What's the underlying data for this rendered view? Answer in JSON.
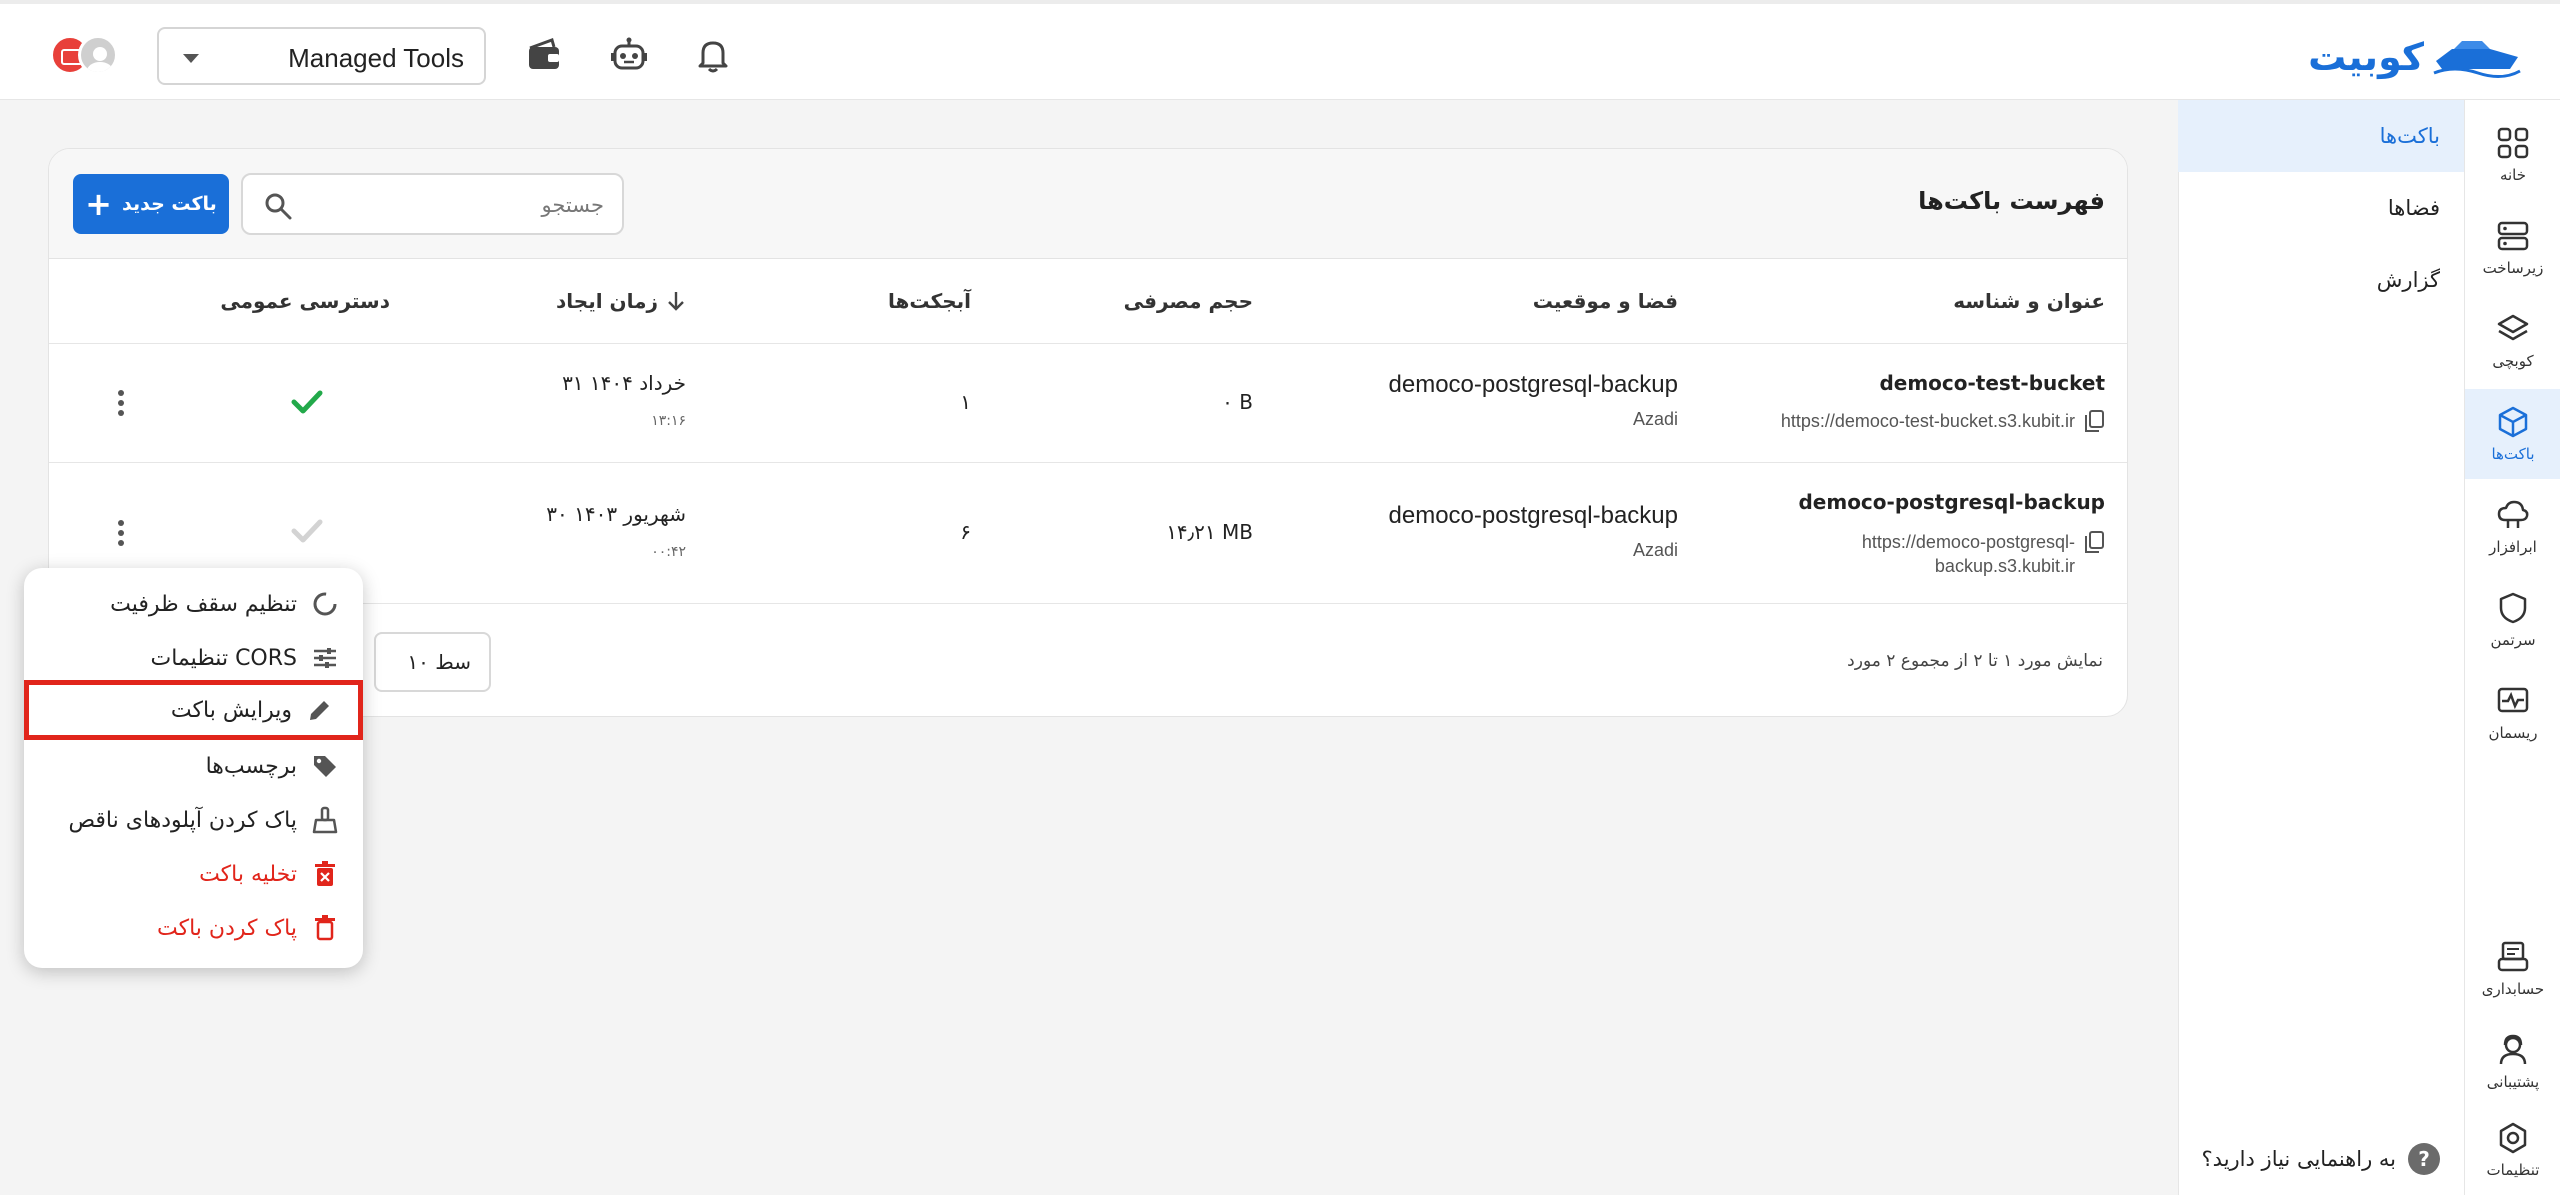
{
  "header": {
    "brand": "کوبیت",
    "project_select": "Managed Tools",
    "icons": [
      "wallet-icon",
      "robot-icon",
      "bell-icon"
    ]
  },
  "rail": [
    {
      "label": "خانه",
      "icon": "home-grid-icon"
    },
    {
      "label": "زیرساخت",
      "icon": "server-icon"
    },
    {
      "label": "کوبچی",
      "icon": "layers-icon"
    },
    {
      "label": "باکت‌ها",
      "icon": "cube-icon",
      "active": true
    },
    {
      "label": "ابرافزار",
      "icon": "cloud-icon"
    },
    {
      "label": "سرتمن",
      "icon": "shield-icon"
    },
    {
      "label": "ریسمان",
      "icon": "monitor-icon"
    },
    {
      "label": "حسابداری",
      "icon": "receipt-icon"
    },
    {
      "label": "پشتیبانی",
      "icon": "support-icon"
    },
    {
      "label": "تنظیمات",
      "icon": "settings-icon"
    }
  ],
  "subnav": {
    "items": [
      "باکت‌ها",
      "فضاها",
      "گزارش"
    ],
    "help": "به راهنمایی نیاز دارید؟",
    "help_icon": "?"
  },
  "card": {
    "title": "فهرست باکت‌ها",
    "new_button": "باکت جدید",
    "search_placeholder": "جستجو",
    "columns": {
      "name": "عنوان و شناسه",
      "space": "فضا و موقعیت",
      "size": "حجم مصرفی",
      "objects": "آبجکت‌ها",
      "created": "زمان ایجاد",
      "public": "دسترسی عمومی"
    },
    "rows": [
      {
        "name": "democo-test-bucket",
        "url": "https://democo-test-bucket.s3.kubit.ir",
        "space": "democo-postgresql-backup",
        "location": "Azadi",
        "size": "۰ B",
        "objects": "۱",
        "date": "۳۱ خرداد ۱۴۰۴",
        "time": "۱۳:۱۶",
        "public": true
      },
      {
        "name": "democo-postgresql-backup",
        "url_line1": "https://democo-postgresql-",
        "url_line2": "backup.s3.kubit.ir",
        "space": "democo-postgresql-backup",
        "location": "Azadi",
        "size": "۱۴٫۲۱ MB",
        "objects": "۶",
        "date": "۳۰ شهریور ۱۴۰۳",
        "time": "۰۰:۴۲",
        "public": false
      }
    ],
    "footer": "نمایش مورد ۱ تا ۲ از مجموع ۲ مورد",
    "pager": "۱۰ سط"
  },
  "menu": [
    {
      "label": "تنظیم سقف ظرفیت",
      "icon": "capacity-icon"
    },
    {
      "label": "تنظیمات CORS",
      "icon": "sliders-icon"
    },
    {
      "label": "ویرایش باکت",
      "icon": "pencil-icon",
      "highlighted": true
    },
    {
      "label": "برچسب‌ها",
      "icon": "tag-icon"
    },
    {
      "label": "پاک کردن آپلودهای ناقص",
      "icon": "broom-icon"
    },
    {
      "label": "تخلیه باکت",
      "icon": "trash-x-icon",
      "danger": true
    },
    {
      "label": "پاک کردن باکت",
      "icon": "trash-icon",
      "danger": true
    }
  ],
  "colors": {
    "accent": "#1a6fd8",
    "danger": "#e1251b",
    "success": "#22a94a"
  }
}
